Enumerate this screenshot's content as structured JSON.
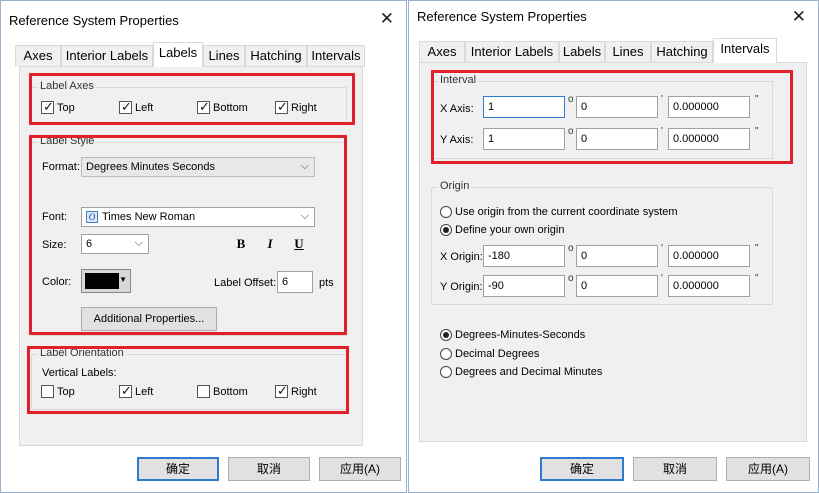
{
  "left": {
    "title": "Reference System Properties",
    "tabs": [
      "Axes",
      "Interior Labels",
      "Labels",
      "Lines",
      "Hatching",
      "Intervals"
    ],
    "active_tab": "Labels",
    "label_axes": {
      "heading": "Label Axes",
      "items": [
        {
          "label": "Top",
          "checked": true
        },
        {
          "label": "Left",
          "checked": true
        },
        {
          "label": "Bottom",
          "checked": true
        },
        {
          "label": "Right",
          "checked": true
        }
      ]
    },
    "label_style": {
      "heading": "Label Style",
      "format_label": "Format:",
      "format_value": "Degrees Minutes Seconds",
      "font_label": "Font:",
      "font_value": "Times New Roman",
      "size_label": "Size:",
      "size_value": "6",
      "bold": "B",
      "italic": "I",
      "underline": "U",
      "color_label": "Color:",
      "color_value": "#000000",
      "offset_label": "Label Offset:",
      "offset_value": "6",
      "offset_unit": "pts",
      "additional_button": "Additional Properties..."
    },
    "label_orientation": {
      "heading": "Label Orientation",
      "vertical_labels": "Vertical Labels:",
      "items": [
        {
          "label": "Top",
          "checked": false
        },
        {
          "label": "Left",
          "checked": true
        },
        {
          "label": "Bottom",
          "checked": false
        },
        {
          "label": "Right",
          "checked": true
        }
      ]
    },
    "buttons": {
      "ok": "确定",
      "cancel": "取消",
      "apply": "应用(A)"
    }
  },
  "right": {
    "title": "Reference System Properties",
    "tabs": [
      "Axes",
      "Interior Labels",
      "Labels",
      "Lines",
      "Hatching",
      "Intervals"
    ],
    "active_tab": "Intervals",
    "interval": {
      "heading": "Interval",
      "x_label": "X Axis:",
      "x_deg": "1",
      "x_min": "0",
      "x_sec": "0.000000",
      "y_label": "Y Axis:",
      "y_deg": "1",
      "y_min": "0",
      "y_sec": "0.000000"
    },
    "origin": {
      "heading": "Origin",
      "opt_current": "Use origin from the current coordinate system",
      "opt_define": "Define your own origin",
      "selected": "define",
      "x_label": "X Origin:",
      "x_deg": "-180",
      "x_min": "0",
      "x_sec": "0.000000",
      "y_label": "Y Origin:",
      "y_deg": "-90",
      "y_min": "0",
      "y_sec": "0.000000"
    },
    "units": {
      "options": [
        "Degrees-Minutes-Seconds",
        "Decimal Degrees",
        "Degrees and Decimal Minutes"
      ],
      "selected": 0
    },
    "buttons": {
      "ok": "确定",
      "cancel": "取消",
      "apply": "应用(A)"
    }
  },
  "symbols": {
    "degree": "o",
    "minute": "'",
    "second": "\""
  },
  "accent": "#2f7ad1",
  "highlight": "#e0202a"
}
